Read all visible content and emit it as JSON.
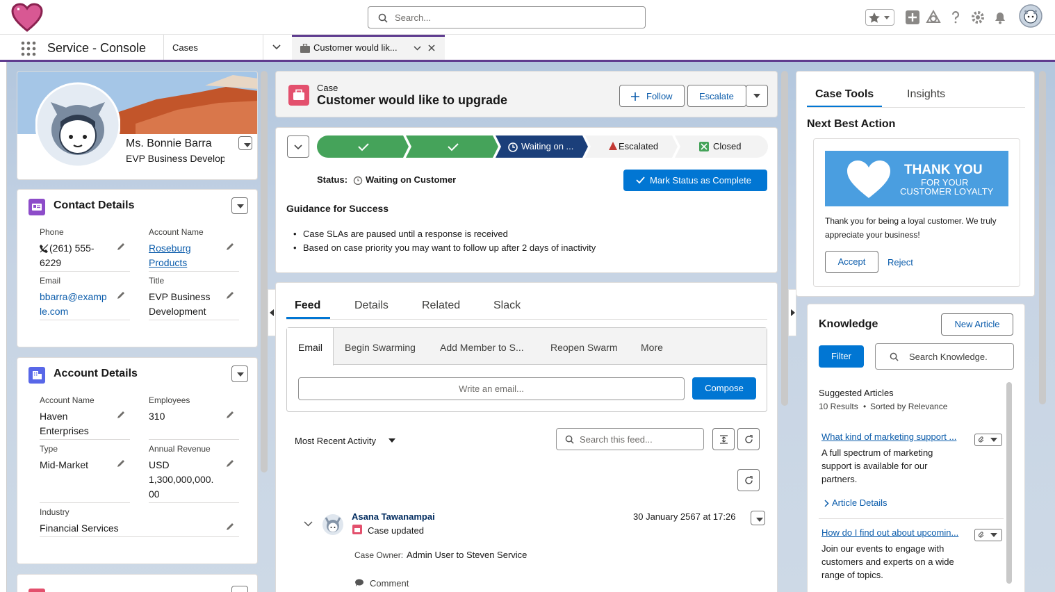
{
  "header": {
    "search_placeholder": "Search..."
  },
  "nav": {
    "app_name": "Service - Console",
    "object_tab": "Cases",
    "record_tab": "Customer would lik..."
  },
  "profile": {
    "name": "Ms. Bonnie Barra",
    "title": "EVP Business Develop"
  },
  "contact": {
    "heading": "Contact Details",
    "phone_label": "Phone",
    "phone_l1": "(261) 555-",
    "phone_l2": "6229",
    "account_label": "Account Name",
    "account_l1": "Roseburg",
    "account_l2": "Products",
    "email_label": "Email",
    "email_l1": "bbarra@examp",
    "email_l2": "le.com",
    "title_label": "Title",
    "title_l1": "EVP Business",
    "title_l2": "Development"
  },
  "account": {
    "heading": "Account Details",
    "name_label": "Account Name",
    "name_l1": "Haven",
    "name_l2": "Enterprises",
    "emp_label": "Employees",
    "emp": "310",
    "type_label": "Type",
    "type": "Mid-Market",
    "rev_label": "Annual Revenue",
    "rev_l1": "USD",
    "rev_l2": "1,300,000,000.",
    "rev_l3": "00",
    "ind_label": "Industry",
    "ind": "Financial Services"
  },
  "case": {
    "label": "Case",
    "title": "Customer would like to upgrade",
    "follow": "Follow",
    "escalate": "Escalate"
  },
  "path": {
    "waiting": "Waiting on ...",
    "escalated": "Escalated",
    "closed": "Closed",
    "status_label": "Status:",
    "status_value": "Waiting on Customer",
    "mark_complete": "Mark Status as Complete",
    "guidance_title": "Guidance for Success",
    "bullet1": "Case SLAs are paused until a response is received",
    "bullet2": "Based on case priority you may want to follow up after 2 days of inactivity"
  },
  "feed": {
    "tabs": [
      "Feed",
      "Details",
      "Related",
      "Slack"
    ],
    "pub_tabs": [
      "Email",
      "Begin Swarming",
      "Add Member to S...",
      "Reopen Swarm",
      "More"
    ],
    "write_placeholder": "Write an email...",
    "compose": "Compose",
    "sort": "Most Recent Activity",
    "search_placeholder": "Search this feed...",
    "author": "Asana Tawanampai",
    "timestamp": "30 January 2567 at 17:26",
    "action": "Case updated",
    "owner_label": "Case Owner:",
    "owner_value": "Admin User to Steven Service",
    "comment": "Comment"
  },
  "tools": {
    "tab1": "Case Tools",
    "tab2": "Insights",
    "nba_title": "Next Best Action",
    "banner_l1": "THANK YOU",
    "banner_l2": "FOR YOUR",
    "banner_l3": "CUSTOMER LOYALTY",
    "nba_text1": "Thank you for being a loyal customer. We truly",
    "nba_text2": "appreciate your business!",
    "accept": "Accept",
    "reject": "Reject"
  },
  "knowledge": {
    "title": "Knowledge",
    "new_article": "New Article",
    "filter": "Filter",
    "search_placeholder": "Search Knowledge.",
    "suggested": "Suggested Articles",
    "results": "10 Results",
    "sorted": "Sorted by Relevance",
    "a1_title": "What kind of marketing support ...",
    "a1_l1": "A full spectrum of marketing",
    "a1_l2": "support is available for our",
    "a1_l3": "partners.",
    "details": "Article Details",
    "a2_title": "How do I find out about upcomin...",
    "a2_l1": "Join our events to engage with",
    "a2_l2": "customers and experts on a wide",
    "a2_l3": "range of topics."
  },
  "colors": {
    "brand": "#0176d3",
    "path_done": "#45a35a",
    "path_current": "#1b3f7a",
    "nav_accent": "#5f3c8f"
  }
}
